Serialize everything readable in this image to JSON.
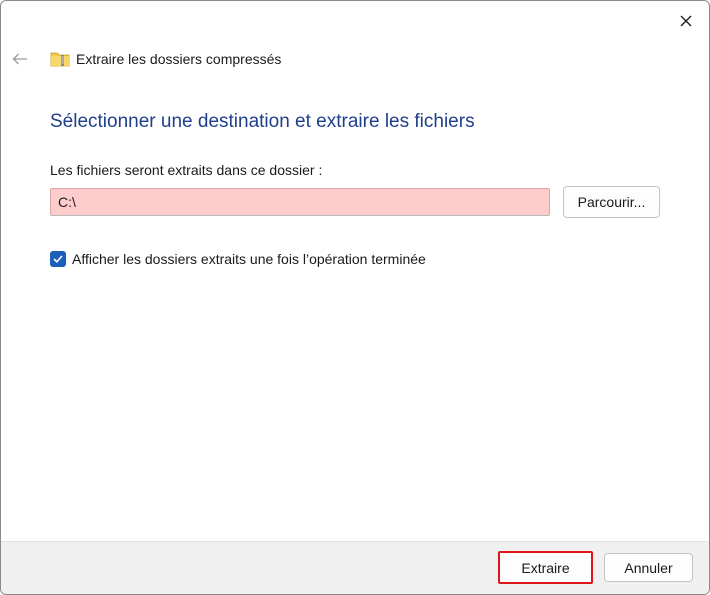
{
  "window": {
    "title": "Extraire les dossiers compressés",
    "icons": {
      "close": "close-icon",
      "back": "back-arrow-icon",
      "folder": "zip-folder-icon"
    }
  },
  "main": {
    "heading": "Sélectionner une destination et extraire les fichiers",
    "destination_label": "Les fichiers seront extraits dans ce dossier :",
    "destination_value": "C:\\",
    "browse_label": "Parcourir...",
    "show_folders_label": "Afficher les dossiers extraits une fois l’opération terminée",
    "show_folders_checked": true
  },
  "footer": {
    "extract_label": "Extraire",
    "cancel_label": "Annuler"
  },
  "colors": {
    "heading": "#1f3f8c",
    "input_background": "#ffcccc",
    "checkbox": "#1b5fb8",
    "highlight_border": "#e0151b"
  }
}
